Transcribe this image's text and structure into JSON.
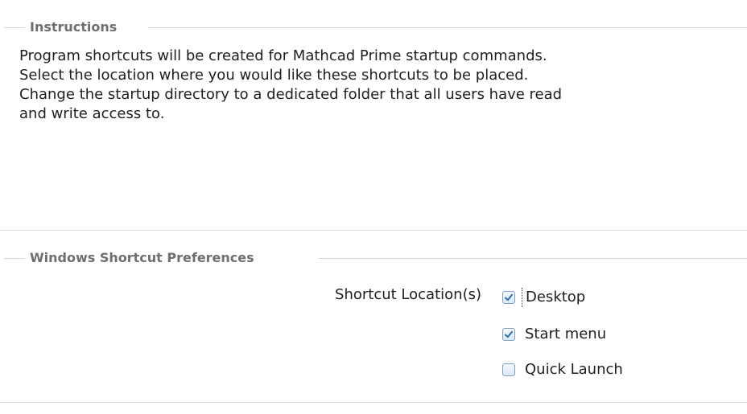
{
  "instructions": {
    "title": "Instructions",
    "lines": [
      "Program shortcuts will be created for Mathcad Prime startup commands.",
      "Select the location where you would like these shortcuts to be placed.",
      "Change the startup directory to a dedicated folder that all users have read",
      "and write access to."
    ]
  },
  "preferences": {
    "title": "Windows Shortcut Preferences",
    "location_label": "Shortcut Location(s)",
    "options": [
      {
        "label": "Desktop",
        "checked": true,
        "focused": true
      },
      {
        "label": "Start menu",
        "checked": true,
        "focused": false
      },
      {
        "label": "Quick Launch",
        "checked": false,
        "focused": false
      }
    ]
  },
  "colors": {
    "accent": "#2a6fb8",
    "group_title": "#6f6f6f",
    "rule": "#d4d4d4"
  }
}
